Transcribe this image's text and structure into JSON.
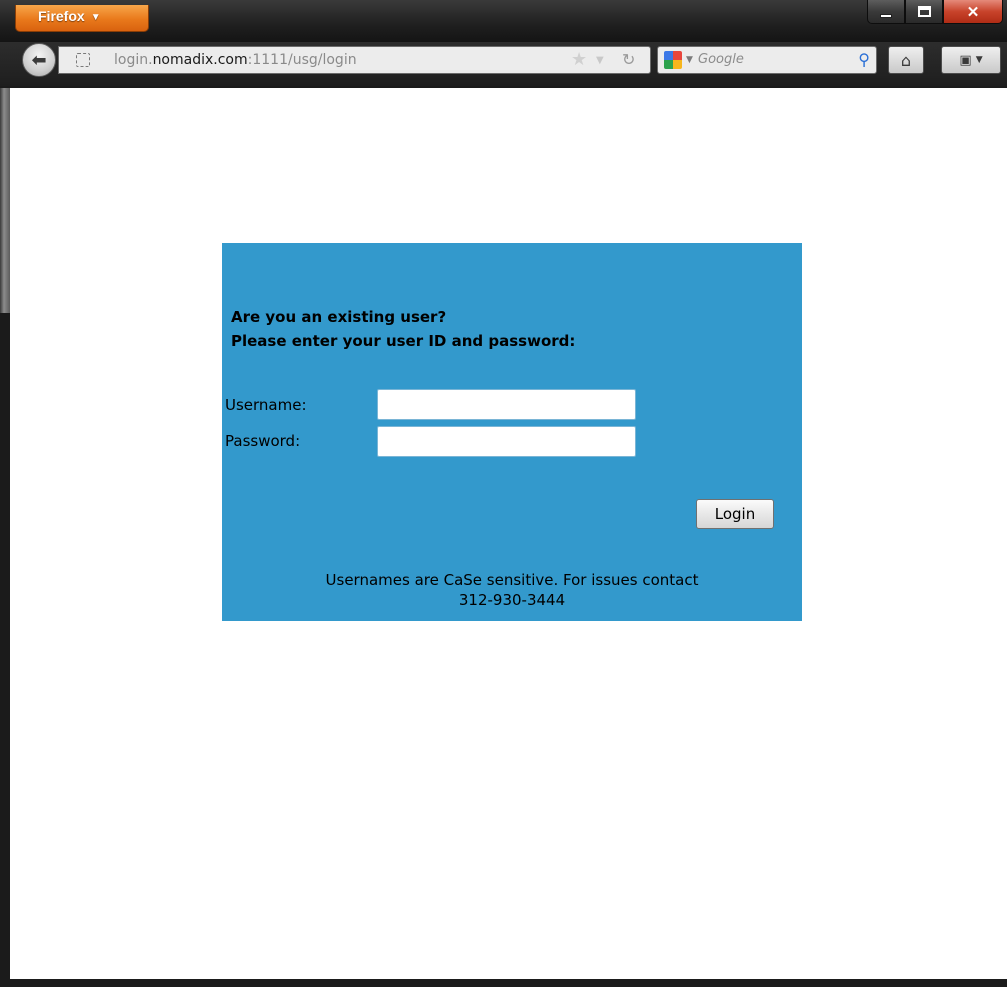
{
  "browser": {
    "menu_button_label": "Firefox",
    "url": {
      "subdomain": "login.",
      "domain": "nomadix.com",
      "rest": ":1111/usg/login"
    },
    "search": {
      "placeholder": "Google",
      "engine_icon": "google-icon"
    },
    "icons": {
      "back": "back-arrow-icon",
      "home": "home-icon",
      "bookmarks": "bookmarks-menu-icon",
      "reload": "reload-icon",
      "star": "bookmark-star-icon"
    }
  },
  "login": {
    "heading_line1": "Are you an existing user?",
    "heading_line2": "Please enter your user ID and password:",
    "username_label": "Username:",
    "password_label": "Password:",
    "username_value": "",
    "password_value": "",
    "login_button": "Login",
    "notice_line1": "Usernames are CaSe sensitive. For issues contact",
    "notice_line2": "312-930-3444"
  },
  "colors": {
    "panel_background": "#3399cc",
    "firefox_button": "#e9791b",
    "close_button": "#c8432b"
  }
}
